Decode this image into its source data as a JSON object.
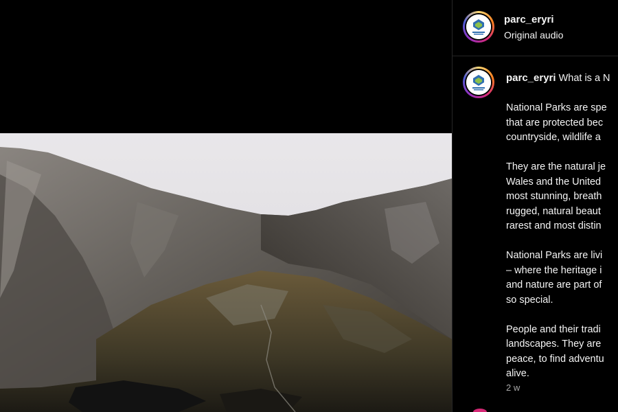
{
  "post": {
    "username": "parc_eryri",
    "audio": "Original audio"
  },
  "caption": {
    "username": "parc_eryri",
    "intro": "What is a N",
    "paragraphs": [
      [
        "National Parks are spe",
        "that are protected bec",
        "countryside, wildlife a"
      ],
      [
        "They are the natural je",
        "Wales and the United",
        "most stunning, breath",
        "rugged, natural beaut",
        "rarest and most distin"
      ],
      [
        "National Parks are livi",
        "– where the heritage i",
        "and nature are part of",
        "so special."
      ],
      [
        "People and their tradi",
        "landscapes. They are",
        "peace, to find adventu",
        "alive."
      ]
    ],
    "time": "2 w"
  },
  "colors": {
    "background": "#000000",
    "text": "#f5f5f5",
    "muted": "#a8a8a8",
    "divider": "#262626"
  },
  "icons": {
    "avatar": "national-park-logo-icon"
  }
}
